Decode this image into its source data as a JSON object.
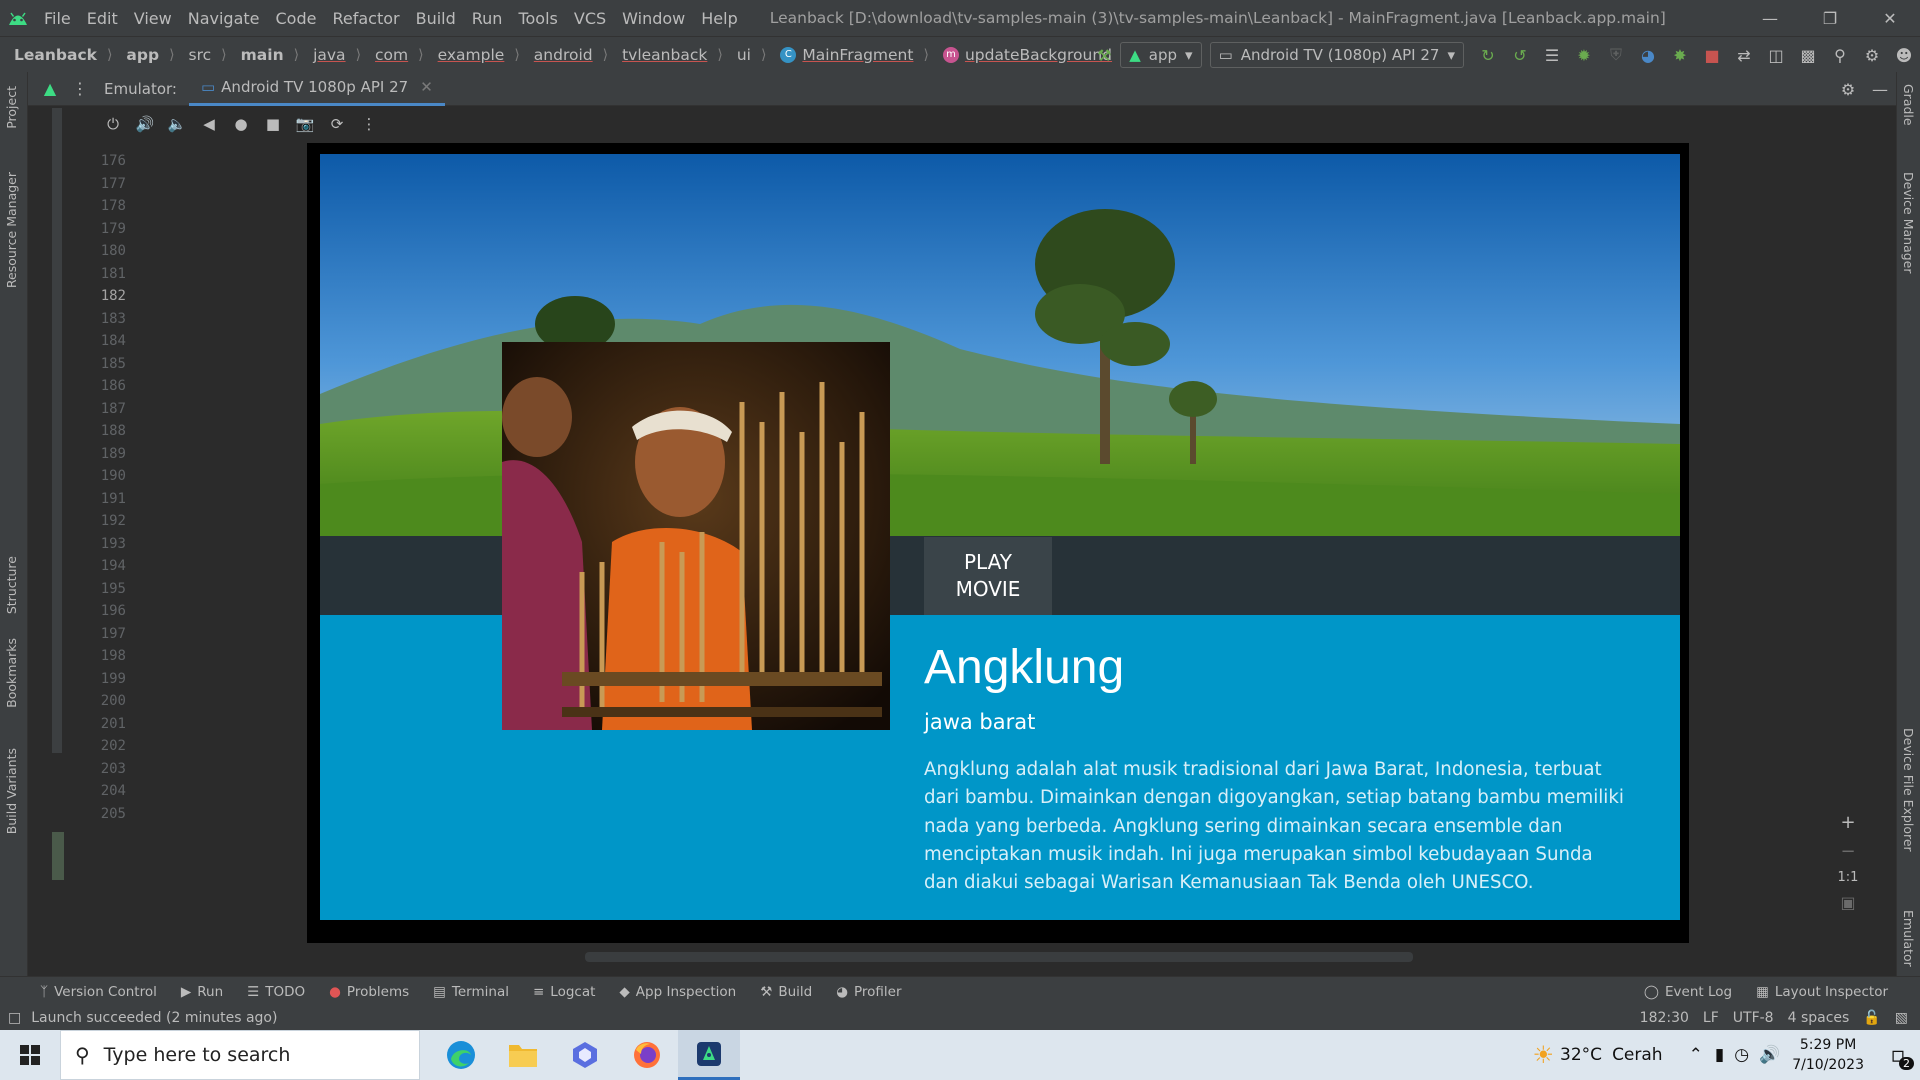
{
  "menubar": {
    "items": [
      "File",
      "Edit",
      "View",
      "Navigate",
      "Code",
      "Refactor",
      "Build",
      "Run",
      "Tools",
      "VCS",
      "Window",
      "Help"
    ],
    "window_title": "Leanback [D:\\download\\tv-samples-main (3)\\tv-samples-main\\Leanback] - MainFragment.java [Leanback.app.main]"
  },
  "navbar": {
    "crumbs": [
      "Leanback",
      "app",
      "src",
      "main",
      "java",
      "com",
      "example",
      "android",
      "tvleanback",
      "ui",
      "MainFragment",
      "updateBackground"
    ],
    "run_config": "app",
    "device": "Android TV (1080p) API 27"
  },
  "left_strip": {
    "tabs": [
      "Project",
      "Resource Manager",
      "Structure",
      "Bookmarks",
      "Build Variants"
    ]
  },
  "right_strip": {
    "tabs": [
      "Gradle",
      "Device Manager",
      "Device File Explorer",
      "Emulator"
    ]
  },
  "emulator": {
    "label": "Emulator:",
    "tab_title": "Android TV 1080p API 27"
  },
  "gutter": {
    "lines": [
      "176",
      "177",
      "178",
      "179",
      "180",
      "181",
      "182",
      "183",
      "184",
      "185",
      "186",
      "187",
      "188",
      "189",
      "190",
      "191",
      "192",
      "193",
      "194",
      "195",
      "196",
      "197",
      "198",
      "199",
      "200",
      "201",
      "202",
      "203",
      "204",
      "205"
    ],
    "current_line": "182"
  },
  "tv": {
    "play_button": "PLAY\nMOVIE",
    "title": "Angklung",
    "subtitle": "jawa barat",
    "description": "Angklung adalah alat musik tradisional dari Jawa Barat, Indonesia, terbuat dari bambu. Dimainkan dengan digoyangkan, setiap batang bambu memiliki nada yang berbeda. Angklung sering dimainkan secara ensemble dan menciptakan musik indah. Ini juga merupakan simbol kebudayaan Sunda dan diakui sebagai Warisan Kemanusiaan Tak Benda oleh UNESCO."
  },
  "emulator_side": {
    "zoom_in": "+",
    "zoom_out": "−",
    "actual_size": "1:1"
  },
  "toolwindows": {
    "left": [
      "Version Control",
      "Run",
      "TODO",
      "Problems",
      "Terminal",
      "Logcat",
      "App Inspection",
      "Build",
      "Profiler"
    ],
    "right": [
      "Event Log",
      "Layout Inspector"
    ]
  },
  "status": {
    "message": "Launch succeeded (2 minutes ago)",
    "position": "182:30",
    "line_sep": "LF",
    "encoding": "UTF-8",
    "indent": "4 spaces"
  },
  "taskbar": {
    "search_placeholder": "Type here to search",
    "weather_temp": "32°C",
    "weather_desc": "Cerah",
    "time": "5:29 PM",
    "date": "7/10/2023",
    "notification_count": "2"
  },
  "colors": {
    "ide_bg": "#2b2b2b",
    "ide_panel": "#3c3f41",
    "tv_detail_bg": "#0096c8",
    "tv_action_bar": "#273238",
    "accent": "#4a88c7"
  }
}
